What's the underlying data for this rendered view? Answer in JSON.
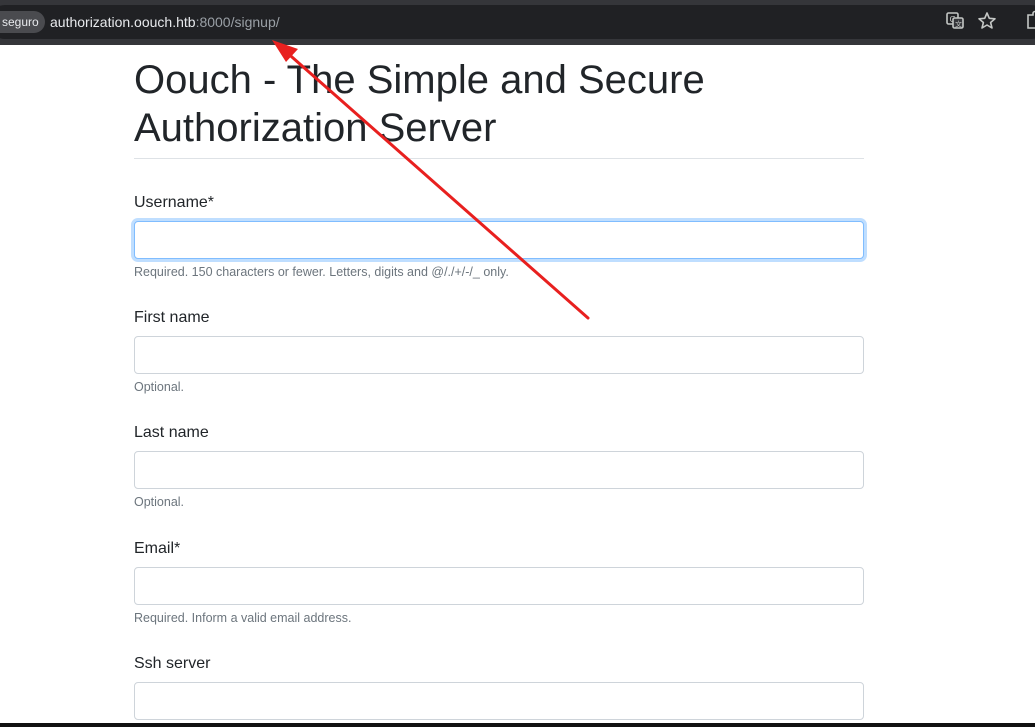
{
  "browser": {
    "security_label": "seguro",
    "url_host": "authorization.oouch.htb",
    "url_path": ":8000/signup/",
    "icons": [
      "translate-icon",
      "bookmark-star-icon",
      "extension-icon"
    ]
  },
  "page": {
    "title_line1": "Oouch - The Simple and Secure",
    "title_line2": "Authorization Server"
  },
  "form": {
    "username": {
      "label": "Username*",
      "value": "",
      "help": "Required. 150 characters or fewer. Letters, digits and @/./+/-/_ only."
    },
    "first_name": {
      "label": "First name",
      "value": "",
      "help": "Optional."
    },
    "last_name": {
      "label": "Last name",
      "value": "",
      "help": "Optional."
    },
    "email": {
      "label": "Email*",
      "value": "",
      "help": "Required. Inform a valid email address."
    },
    "ssh_server": {
      "label": "Ssh server",
      "value": ""
    }
  },
  "colors": {
    "annotation_arrow": "#e8201f",
    "focus_ring": "#80bdff",
    "browser_bar": "#35363a"
  }
}
